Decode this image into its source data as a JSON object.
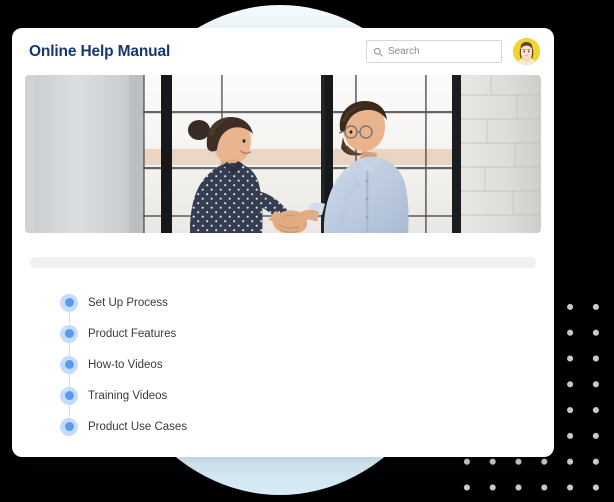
{
  "window": {
    "title": "Online Help Manual"
  },
  "colors": {
    "title_navy": "#17376e",
    "accent_blue": "#5a9bf1",
    "accent_blue_halo": "#c5ddf8",
    "avatar_background": "#f2d42a",
    "background_circle": "#e6f2f9",
    "dot_grid": "#c9c9c9",
    "placeholder_bar": "#f0f0f2"
  },
  "header": {
    "title": "Online Help Manual",
    "search": {
      "icon": "search-icon",
      "placeholder": "Search",
      "value": ""
    },
    "avatar": {
      "icon": "user-avatar",
      "alt": "User profile photo"
    }
  },
  "hero": {
    "alt": "Two colleagues shaking hands in a bright loft office with large windows"
  },
  "content": {
    "placeholder_bar": "",
    "topics": [
      {
        "label": "Set Up Process"
      },
      {
        "label": "Product Features"
      },
      {
        "label": "How-to Videos"
      },
      {
        "label": "Training Videos"
      },
      {
        "label": "Product Use Cases"
      }
    ]
  },
  "decorations": {
    "dot_grid": "dot-grid-pattern",
    "circle": "blue-circle-shape"
  }
}
